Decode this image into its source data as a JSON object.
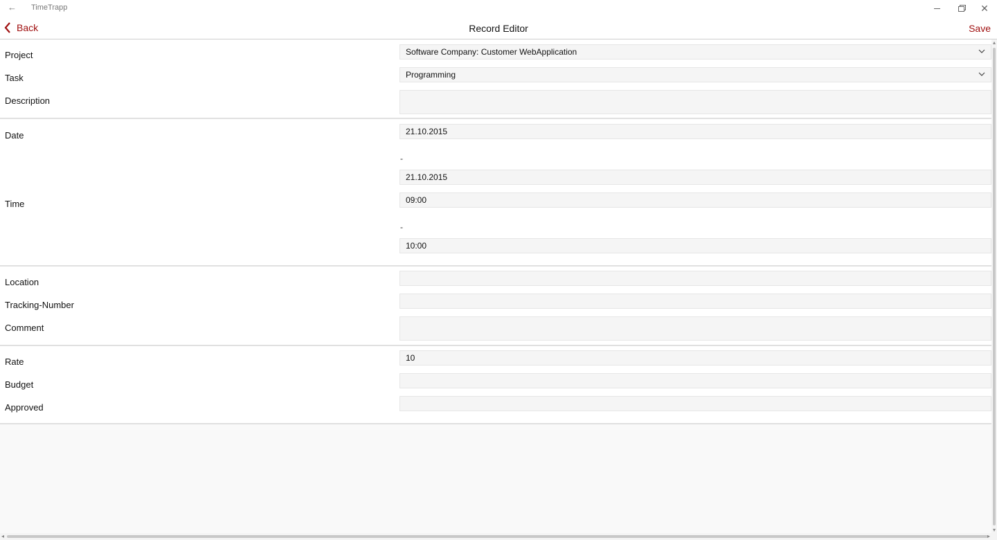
{
  "window": {
    "app_title": "TimeTrapp"
  },
  "commandbar": {
    "back_label": "Back",
    "title": "Record Editor",
    "save_label": "Save"
  },
  "form": {
    "project": {
      "label": "Project",
      "value": "Software Company: Customer WebApplication"
    },
    "task": {
      "label": "Task",
      "value": "Programming"
    },
    "description": {
      "label": "Description",
      "value": ""
    },
    "date": {
      "label": "Date",
      "start": "21.10.2015",
      "separator": "-",
      "end": "21.10.2015"
    },
    "time": {
      "label": "Time",
      "start": "09:00",
      "separator": "-",
      "end": "10:00"
    },
    "location": {
      "label": "Location",
      "value": ""
    },
    "tracking_number": {
      "label": "Tracking-Number",
      "value": ""
    },
    "comment": {
      "label": "Comment",
      "value": ""
    },
    "rate": {
      "label": "Rate",
      "value": "10"
    },
    "budget": {
      "label": "Budget",
      "value": ""
    },
    "approved": {
      "label": "Approved",
      "value": ""
    }
  },
  "icons": {
    "titlebar_back": "arrow-left-icon",
    "back": "chevron-left-icon",
    "dropdown": "chevron-down-icon",
    "minimize": "minimize-icon",
    "maximize": "restore-icon",
    "close": "close-icon"
  },
  "colors": {
    "accent": "#a01010",
    "field_background": "#f5f5f5",
    "page_background": "#f9f9f9"
  }
}
